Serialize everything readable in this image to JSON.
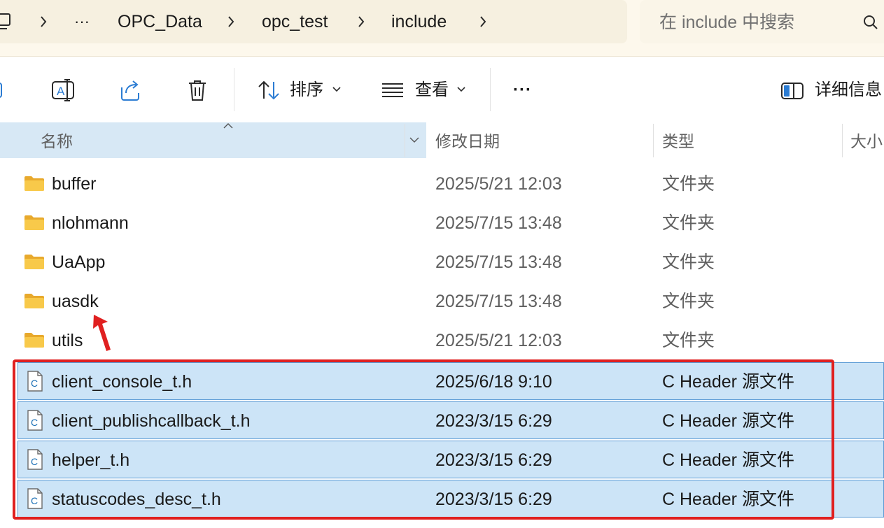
{
  "address_bar": {
    "ellipsis": "···",
    "crumbs": [
      "OPC_Data",
      "opc_test",
      "include"
    ]
  },
  "search": {
    "placeholder": "在 include 中搜索"
  },
  "toolbar": {
    "sort_label": "排序",
    "view_label": "查看",
    "more_label": "···",
    "details_label": "详细信息"
  },
  "columns": {
    "name": "名称",
    "modified": "修改日期",
    "type": "类型",
    "size": "大小"
  },
  "files": [
    {
      "name": "buffer",
      "modified": "2025/5/21 12:03",
      "type": "文件夹",
      "kind": "folder",
      "selected": false
    },
    {
      "name": "nlohmann",
      "modified": "2025/7/15 13:48",
      "type": "文件夹",
      "kind": "folder",
      "selected": false
    },
    {
      "name": "UaApp",
      "modified": "2025/7/15 13:48",
      "type": "文件夹",
      "kind": "folder",
      "selected": false
    },
    {
      "name": "uasdk",
      "modified": "2025/7/15 13:48",
      "type": "文件夹",
      "kind": "folder",
      "selected": false
    },
    {
      "name": "utils",
      "modified": "2025/5/21 12:03",
      "type": "文件夹",
      "kind": "folder",
      "selected": false
    },
    {
      "name": "client_console_t.h",
      "modified": "2025/6/18 9:10",
      "type": "C Header 源文件",
      "kind": "c-header",
      "selected": true
    },
    {
      "name": "client_publishcallback_t.h",
      "modified": "2023/3/15 6:29",
      "type": "C Header 源文件",
      "kind": "c-header",
      "selected": true
    },
    {
      "name": "helper_t.h",
      "modified": "2023/3/15 6:29",
      "type": "C Header 源文件",
      "kind": "c-header",
      "selected": true
    },
    {
      "name": "statuscodes_desc_t.h",
      "modified": "2023/3/15 6:29",
      "type": "C Header 源文件",
      "kind": "c-header",
      "selected": true
    }
  ],
  "colors": {
    "selection_fill": "#cce4f7",
    "selection_border": "#5b9bd5",
    "annotation_red": "#e02020",
    "folder_yellow": "#f8c94a"
  }
}
